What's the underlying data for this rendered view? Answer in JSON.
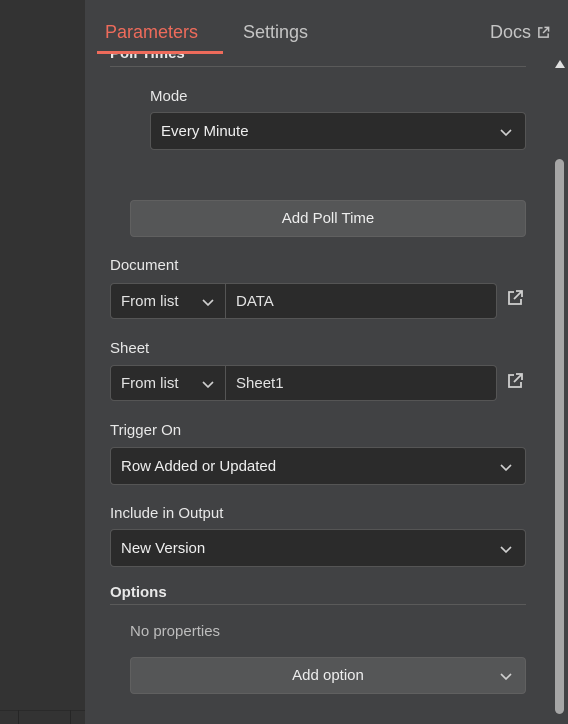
{
  "tabs": {
    "parameters": "Parameters",
    "settings": "Settings",
    "docs": "Docs"
  },
  "poll_times": {
    "header": "Poll Times",
    "mode_label": "Mode",
    "mode_value": "Every Minute",
    "add_button": "Add Poll Time"
  },
  "document": {
    "label": "Document",
    "mode": "From list",
    "value": "DATA"
  },
  "sheet": {
    "label": "Sheet",
    "mode": "From list",
    "value": "Sheet1"
  },
  "trigger_on": {
    "label": "Trigger On",
    "value": "Row Added or Updated"
  },
  "include_in_output": {
    "label": "Include in Output",
    "value": "New Version"
  },
  "options": {
    "header": "Options",
    "empty_text": "No properties",
    "add_button": "Add option"
  },
  "icons": {
    "chevron": "chevron-down-icon",
    "external": "external-link-icon",
    "scroll_up": "scroll-up-arrow-icon"
  },
  "colors": {
    "accent": "#ee6b5b",
    "panel": "#414244",
    "input": "#2b2b2b"
  }
}
